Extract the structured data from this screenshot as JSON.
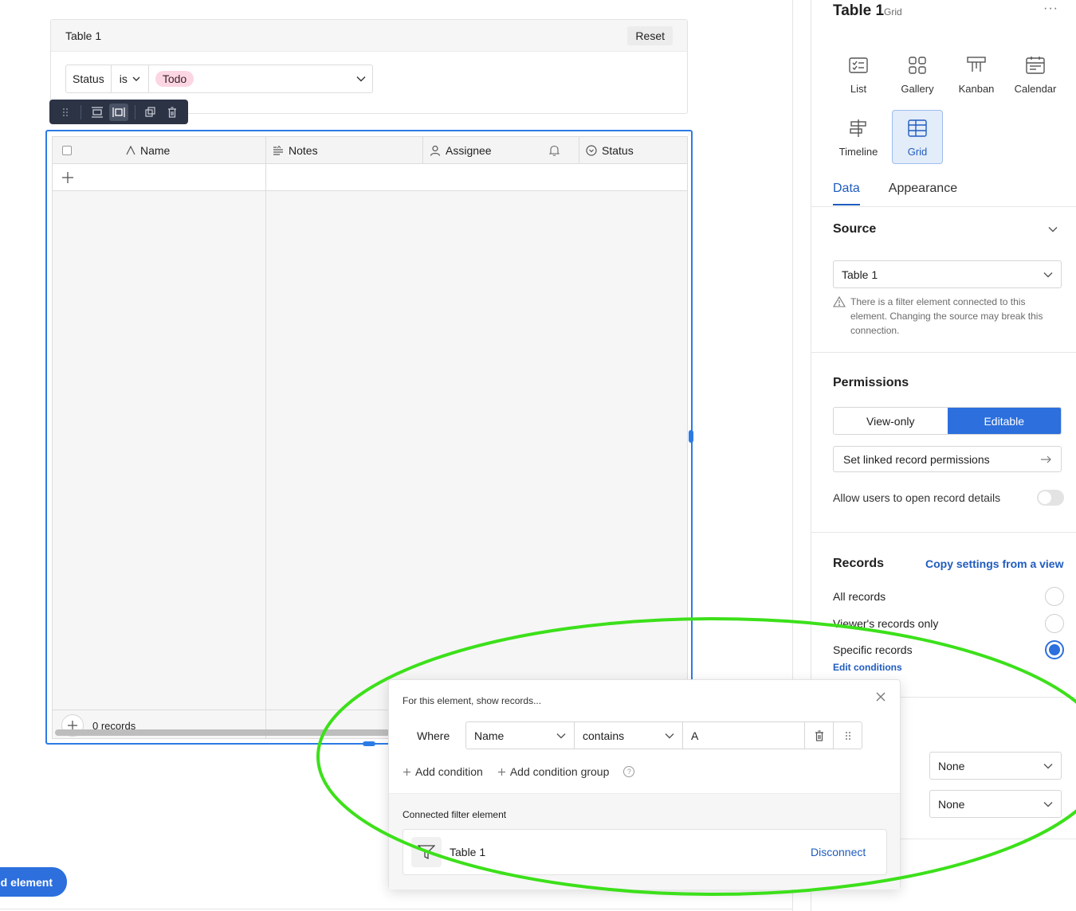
{
  "canvas": {
    "filter_element": {
      "title": "Table 1",
      "reset_label": "Reset",
      "filter": {
        "field": "Status",
        "operator": "is",
        "value": "Todo"
      }
    },
    "grid": {
      "columns": [
        "Name",
        "Notes",
        "Assignee",
        "Status"
      ],
      "record_count": "0 records"
    },
    "add_element_label": "d element"
  },
  "panel": {
    "title": "Table 1",
    "title_sub": "Grid",
    "more": "···",
    "viz": [
      {
        "label": "List",
        "icon": "list-icon"
      },
      {
        "label": "Gallery",
        "icon": "gallery-icon"
      },
      {
        "label": "Kanban",
        "icon": "kanban-icon"
      },
      {
        "label": "Calendar",
        "icon": "calendar-icon"
      },
      {
        "label": "Timeline",
        "icon": "timeline-icon"
      },
      {
        "label": "Grid",
        "icon": "grid-icon",
        "selected": true
      }
    ],
    "tabs": {
      "data": "Data",
      "appearance": "Appearance",
      "active": "Data"
    },
    "source": {
      "title": "Source",
      "value": "Table 1",
      "warning": "There is a filter element connected to this element. Changing the source may break this connection."
    },
    "permissions": {
      "title": "Permissions",
      "view_only": "View-only",
      "editable": "Editable",
      "selected": "Editable",
      "linked": "Set linked record permissions",
      "allow_label": "Allow users to open record details",
      "allow_on": false
    },
    "records": {
      "title": "Records",
      "copy_link": "Copy settings from a view",
      "options": [
        {
          "label": "All records",
          "selected": false
        },
        {
          "label": "Viewer's records only",
          "selected": false
        },
        {
          "label": "Specific records",
          "selected": true
        }
      ],
      "edit_conditions": "Edit conditions"
    },
    "selects": [
      "None",
      "None"
    ]
  },
  "popover": {
    "heading": "For this element, show records...",
    "where": "Where",
    "condition": {
      "field": "Name",
      "operator": "contains",
      "value": "A"
    },
    "add_condition": "Add condition",
    "add_group": "Add condition group",
    "help": "?",
    "connected_label": "Connected filter element",
    "connected_name": "Table 1",
    "disconnect": "Disconnect"
  },
  "colors": {
    "accent": "#2c6fdd",
    "link": "#1f5cbf",
    "todo_pill": "#fcd6e3",
    "annotation": "#3ce01a"
  }
}
